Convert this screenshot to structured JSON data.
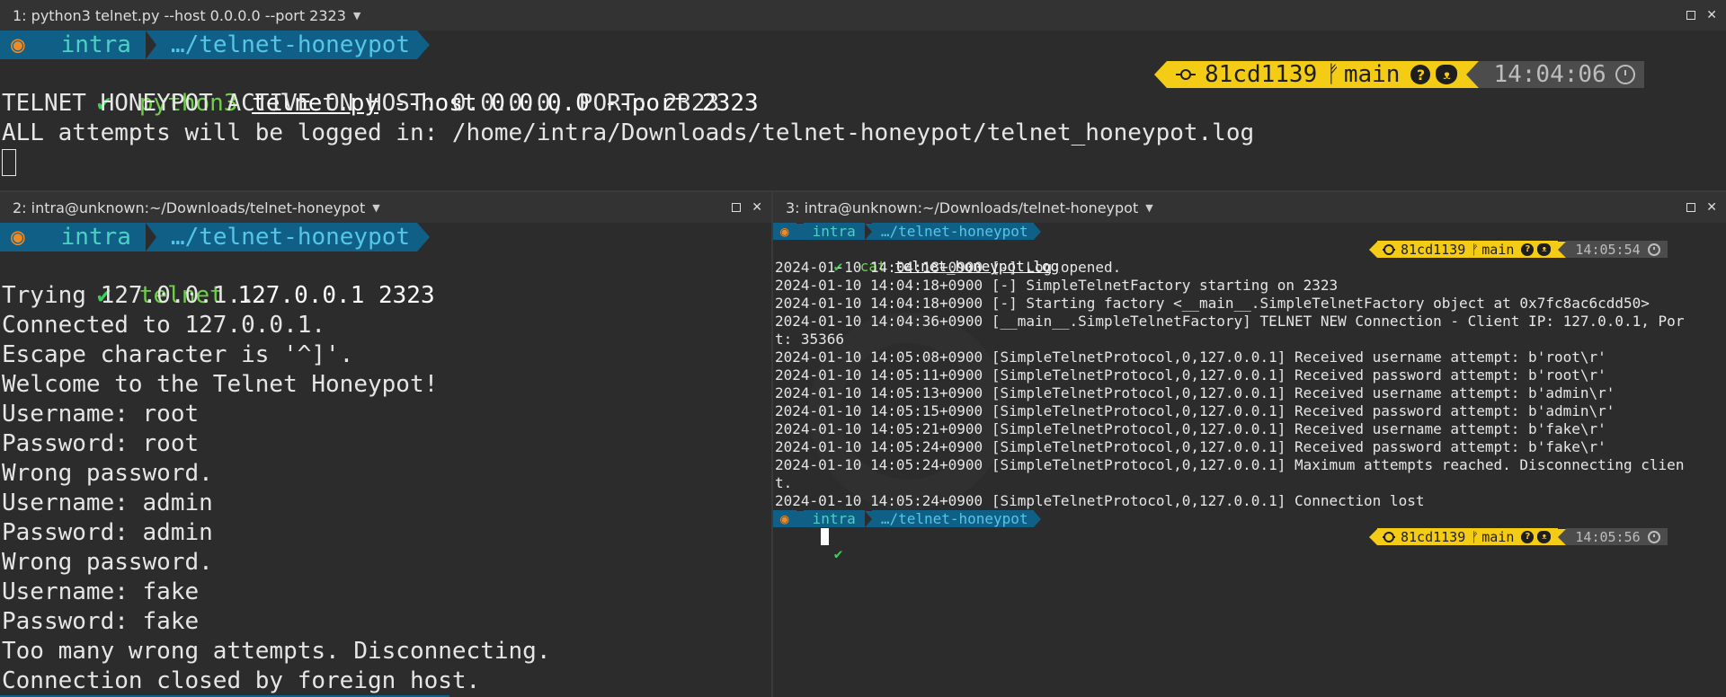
{
  "colors": {
    "bg": "#2c2c2c",
    "titlebar": "#333333",
    "powerline_blue": "#0f5f86",
    "git_yellow": "#f5cc15",
    "time_gray": "#4c4c4c",
    "check_green": "#3ecf5a",
    "os_orange": "#f08a24"
  },
  "pane1": {
    "title": "1: python3 telnet.py --host 0.0.0.0 --port 2323",
    "prompt": {
      "os_icon": "ubuntu-icon",
      "user": "intra",
      "dir": "…/telnet-honeypot"
    },
    "command": {
      "check": "✔",
      "bin": "python3",
      "file": "telnet.py",
      "args": " --host 0.0.0.0 --port 2323"
    },
    "git": {
      "commit": "81cd1139",
      "branch_icon": "ᚠ",
      "branch": "main",
      "status_icon": "?",
      "remote_icon": "github-icon"
    },
    "time": "14:04:06",
    "output": [
      "TELNET HONEYPOT ACTIVE ON HOST: 0.0.0.0, PORT: 2323",
      "ALL attempts will be logged in: /home/intra/Downloads/telnet-honeypot/telnet_honeypot.log"
    ]
  },
  "pane2": {
    "title": "2: intra@unknown:~/Downloads/telnet-honeypot",
    "prompt": {
      "user": "intra",
      "dir": "…/telnet-honeypot"
    },
    "command": {
      "check": "✔",
      "bin": "telnet",
      "args": " 127.0.0.1 2323"
    },
    "output": [
      "Trying 127.0.0.1...",
      "Connected to 127.0.0.1.",
      "Escape character is '^]'.",
      "Welcome to the Telnet Honeypot!",
      "Username: root",
      "Password: root",
      "Wrong password.",
      "Username: admin",
      "Password: admin",
      "Wrong password.",
      "Username: fake",
      "Password: fake",
      "Too many wrong attempts. Disconnecting.",
      "Connection closed by foreign host."
    ]
  },
  "pane3": {
    "title": "3: intra@unknown:~/Downloads/telnet-honeypot",
    "prompt": {
      "user": "intra",
      "dir": "…/telnet-honeypot"
    },
    "command": {
      "check": "✔",
      "bin": "cat",
      "file": "telnet_honeypot.log"
    },
    "git": {
      "commit": "81cd1139",
      "branch_icon": "ᚠ",
      "branch": "main",
      "status_icon": "?"
    },
    "time1": "14:05:54",
    "log": [
      "2024-01-10 14:04:18+0900 [-] Log opened.",
      "2024-01-10 14:04:18+0900 [-] SimpleTelnetFactory starting on 2323",
      "2024-01-10 14:04:18+0900 [-] Starting factory <__main__.SimpleTelnetFactory object at 0x7fc8ac6cdd50>",
      "2024-01-10 14:04:36+0900 [__main__.SimpleTelnetFactory] TELNET NEW Connection - Client IP: 127.0.0.1, Por",
      "t: 35366",
      "2024-01-10 14:05:08+0900 [SimpleTelnetProtocol,0,127.0.0.1] Received username attempt: b'root\\r'",
      "2024-01-10 14:05:11+0900 [SimpleTelnetProtocol,0,127.0.0.1] Received password attempt: b'root\\r'",
      "2024-01-10 14:05:13+0900 [SimpleTelnetProtocol,0,127.0.0.1] Received username attempt: b'admin\\r'",
      "2024-01-10 14:05:15+0900 [SimpleTelnetProtocol,0,127.0.0.1] Received password attempt: b'admin\\r'",
      "2024-01-10 14:05:21+0900 [SimpleTelnetProtocol,0,127.0.0.1] Received username attempt: b'fake\\r'",
      "2024-01-10 14:05:24+0900 [SimpleTelnetProtocol,0,127.0.0.1] Received password attempt: b'fake\\r'",
      "2024-01-10 14:05:24+0900 [SimpleTelnetProtocol,0,127.0.0.1] Maximum attempts reached. Disconnecting clien",
      "t.",
      "2024-01-10 14:05:24+0900 [SimpleTelnetProtocol,0,127.0.0.1] Connection lost"
    ],
    "prompt2": {
      "user": "intra",
      "dir": "…/telnet-honeypot",
      "check": "✔"
    },
    "time2": "14:05:56"
  }
}
